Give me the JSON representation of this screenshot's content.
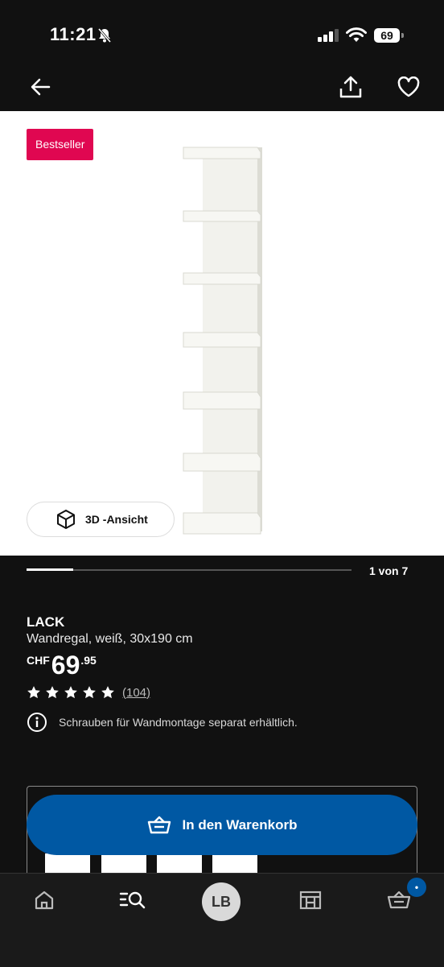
{
  "status_bar": {
    "time": "11:21",
    "battery": "69"
  },
  "product": {
    "badge": "Bestseller",
    "view_3d_label": "3D -Ansicht",
    "carousel": {
      "page_text": "1 von 7",
      "current": 1,
      "total": 7
    },
    "name": "LACK",
    "description": "Wandregal, weiß, 30x190 cm",
    "price": {
      "currency": "CHF",
      "main": "69",
      "decimals": ".95"
    },
    "rating": {
      "stars": 5,
      "reviews": "(104)"
    },
    "info": "Schrauben für Wandmontage separat erhältlich."
  },
  "cart": {
    "button_label": "In den Warenkorb"
  },
  "tabbar": {
    "avatar_initials": "LB",
    "cart_badge": "•"
  },
  "colors": {
    "badge": "#e00751",
    "primary": "#0058a3",
    "background": "#111111"
  }
}
